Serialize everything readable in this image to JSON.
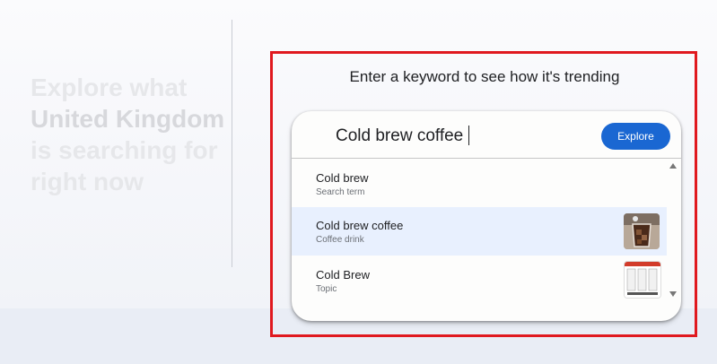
{
  "hero": {
    "line1": "Explore what",
    "country": "United Kingdom",
    "line3": "is searching for",
    "line4": "right now"
  },
  "prompt": "Enter a keyword to see how it's trending",
  "search": {
    "query": "Cold brew coffee",
    "button_label": "Explore"
  },
  "suggestions": [
    {
      "title": "Cold brew",
      "subtitle": "Search term",
      "thumbnail": null
    },
    {
      "title": "Cold brew coffee",
      "subtitle": "Coffee drink",
      "thumbnail": "iced-coffee-photo"
    },
    {
      "title": "Cold Brew",
      "subtitle": "Topic",
      "thumbnail": "document-preview"
    }
  ],
  "colors": {
    "accent": "#1a67d2",
    "highlight_border": "#e0191f",
    "selected_row": "#e8f0fe"
  }
}
